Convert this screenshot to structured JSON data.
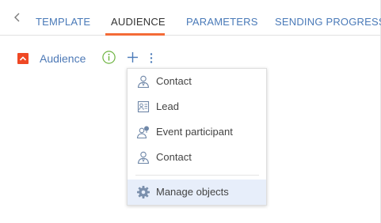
{
  "tabs": [
    {
      "label": "TEMPLATE",
      "active": false
    },
    {
      "label": "AUDIENCE",
      "active": true
    },
    {
      "label": "PARAMETERS",
      "active": false
    },
    {
      "label": "SENDING PROGRESS",
      "active": false
    }
  ],
  "group": {
    "title": "Audience",
    "collapse_icon": "chevron-up-icon",
    "actions": [
      "info-icon",
      "add-icon",
      "more-vertical-icon"
    ]
  },
  "menu": {
    "items": [
      {
        "label": "Contact",
        "icon": "contact-icon"
      },
      {
        "label": "Lead",
        "icon": "lead-icon"
      },
      {
        "label": "Event participant",
        "icon": "event-participant-icon"
      },
      {
        "label": "Contact",
        "icon": "contact-icon"
      }
    ],
    "footer_item": {
      "label": "Manage objects",
      "icon": "gear-icon",
      "highlighted": true
    }
  },
  "colors": {
    "accent": "#f46b37",
    "collapse_button": "#ef4824",
    "link_blue": "#4a7ab8",
    "info_green": "#6cb33f",
    "highlight_row": "#e7eefa"
  }
}
